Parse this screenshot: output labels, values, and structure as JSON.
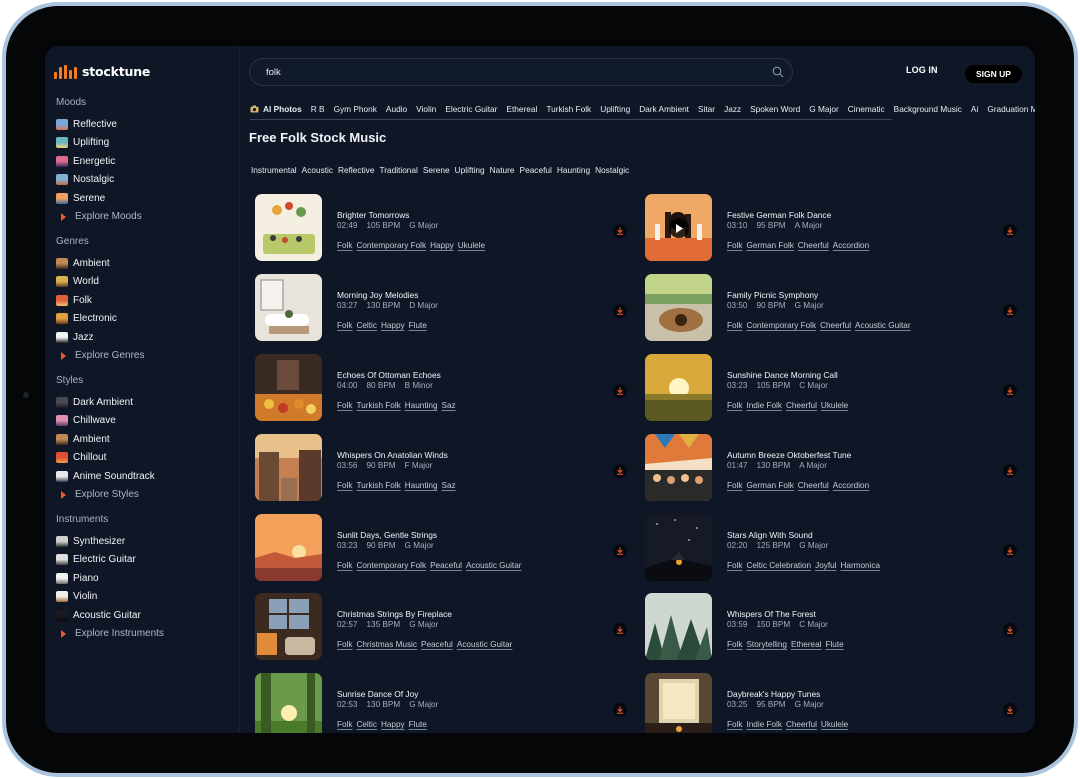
{
  "app": {
    "brand": "stocktune",
    "brand_color": "#f47b20",
    "accent_color": "#f05a28"
  },
  "header": {
    "search_value": "folk",
    "login_label": "LOG IN",
    "signup_label": "SIGN UP"
  },
  "sidebar": {
    "moods": {
      "heading": "Moods",
      "items": [
        {
          "label": "Reflective",
          "icon": "reflective-thumb-icon"
        },
        {
          "label": "Uplifting",
          "icon": "uplifting-thumb-icon"
        },
        {
          "label": "Energetic",
          "icon": "energetic-thumb-icon"
        },
        {
          "label": "Nostalgic",
          "icon": "nostalgic-thumb-icon"
        },
        {
          "label": "Serene",
          "icon": "serene-thumb-icon"
        }
      ],
      "explore": "Explore Moods"
    },
    "genres": {
      "heading": "Genres",
      "items": [
        {
          "label": "Ambient",
          "icon": "ambient-thumb-icon"
        },
        {
          "label": "World",
          "icon": "world-thumb-icon"
        },
        {
          "label": "Folk",
          "icon": "folk-thumb-icon"
        },
        {
          "label": "Electronic",
          "icon": "electronic-thumb-icon"
        },
        {
          "label": "Jazz",
          "icon": "jazz-thumb-icon"
        }
      ],
      "explore": "Explore Genres"
    },
    "styles": {
      "heading": "Styles",
      "items": [
        {
          "label": "Dark Ambient",
          "icon": "dark-ambient-thumb-icon"
        },
        {
          "label": "Chillwave",
          "icon": "chillwave-thumb-icon"
        },
        {
          "label": "Ambient",
          "icon": "ambient-thumb-icon"
        },
        {
          "label": "Chillout",
          "icon": "chillout-thumb-icon"
        },
        {
          "label": "Anime Soundtrack",
          "icon": "anime-thumb-icon"
        }
      ],
      "explore": "Explore Styles"
    },
    "instruments": {
      "heading": "Instruments",
      "items": [
        {
          "label": "Synthesizer",
          "icon": "synthesizer-thumb-icon"
        },
        {
          "label": "Electric Guitar",
          "icon": "electric-guitar-thumb-icon"
        },
        {
          "label": "Piano",
          "icon": "piano-thumb-icon"
        },
        {
          "label": "Violin",
          "icon": "violin-thumb-icon"
        },
        {
          "label": "Acoustic Guitar",
          "icon": "acoustic-guitar-thumb-icon"
        }
      ],
      "explore": "Explore Instruments"
    }
  },
  "chips": [
    "AI Photos",
    "R B",
    "Gym Phonk",
    "Audio",
    "Violin",
    "Electric Guitar",
    "Ethereal",
    "Turkish Folk",
    "Uplifting",
    "Dark Ambient",
    "Sitar",
    "Jazz",
    "Spoken Word",
    "G Major",
    "Cinematic",
    "Background Music",
    "Ai",
    "Graduation March"
  ],
  "page_title": "Free Folk Stock Music",
  "subtags": [
    "Instrumental",
    "Acoustic",
    "Reflective",
    "Traditional",
    "Serene",
    "Uplifting",
    "Nature",
    "Peaceful",
    "Haunting",
    "Nostalgic"
  ],
  "tracks": [
    {
      "title": "Brighter Tomorrows",
      "duration": "02:49",
      "bpm": "105 BPM",
      "key": "G Major",
      "tags": [
        "Folk",
        "Contemporary Folk",
        "Happy",
        "Ukulele"
      ]
    },
    {
      "title": "Festive German Folk Dance",
      "duration": "03:10",
      "bpm": "95 BPM",
      "key": "A Major",
      "tags": [
        "Folk",
        "German Folk",
        "Cheerful",
        "Accordion"
      ]
    },
    {
      "title": "Morning Joy Melodies",
      "duration": "03:27",
      "bpm": "130 BPM",
      "key": "D Major",
      "tags": [
        "Folk",
        "Celtic",
        "Happy",
        "Flute"
      ]
    },
    {
      "title": "Family Picnic Symphony",
      "duration": "03:50",
      "bpm": "90 BPM",
      "key": "G Major",
      "tags": [
        "Folk",
        "Contemporary Folk",
        "Cheerful",
        "Acoustic Guitar"
      ]
    },
    {
      "title": "Echoes Of Ottoman Echoes",
      "duration": "04:00",
      "bpm": "80 BPM",
      "key": "B Minor",
      "tags": [
        "Folk",
        "Turkish Folk",
        "Haunting",
        "Saz"
      ]
    },
    {
      "title": "Sunshine Dance Morning Call",
      "duration": "03:23",
      "bpm": "105 BPM",
      "key": "C Major",
      "tags": [
        "Folk",
        "Indie Folk",
        "Cheerful",
        "Ukulele"
      ]
    },
    {
      "title": "Whispers On Anatolian Winds",
      "duration": "03:56",
      "bpm": "90 BPM",
      "key": "F Major",
      "tags": [
        "Folk",
        "Turkish Folk",
        "Haunting",
        "Saz"
      ]
    },
    {
      "title": "Autumn Breeze Oktoberfest Tune",
      "duration": "01:47",
      "bpm": "130 BPM",
      "key": "A Major",
      "tags": [
        "Folk",
        "German Folk",
        "Cheerful",
        "Accordion"
      ]
    },
    {
      "title": "Sunlit Days, Gentle Strings",
      "duration": "03:23",
      "bpm": "90 BPM",
      "key": "G Major",
      "tags": [
        "Folk",
        "Contemporary Folk",
        "Peaceful",
        "Acoustic Guitar"
      ]
    },
    {
      "title": "Stars Align With Sound",
      "duration": "02:20",
      "bpm": "125 BPM",
      "key": "G Major",
      "tags": [
        "Folk",
        "Celtic Celebration",
        "Joyful",
        "Harmonica"
      ]
    },
    {
      "title": "Christmas Strings By Fireplace",
      "duration": "02:57",
      "bpm": "135 BPM",
      "key": "G Major",
      "tags": [
        "Folk",
        "Christmas Music",
        "Peaceful",
        "Acoustic Guitar"
      ]
    },
    {
      "title": "Whispers Of The Forest",
      "duration": "03:59",
      "bpm": "150 BPM",
      "key": "C Major",
      "tags": [
        "Folk",
        "Storytelling",
        "Ethereal",
        "Flute"
      ]
    },
    {
      "title": "Sunrise Dance Of Joy",
      "duration": "02:53",
      "bpm": "130 BPM",
      "key": "G Major",
      "tags": [
        "Folk",
        "Celtic",
        "Happy",
        "Flute"
      ]
    },
    {
      "title": "Daybreak's Happy Tunes",
      "duration": "03:25",
      "bpm": "95 BPM",
      "key": "G Major",
      "tags": [
        "Folk",
        "Indie Folk",
        "Cheerful",
        "Ukulele"
      ]
    }
  ]
}
